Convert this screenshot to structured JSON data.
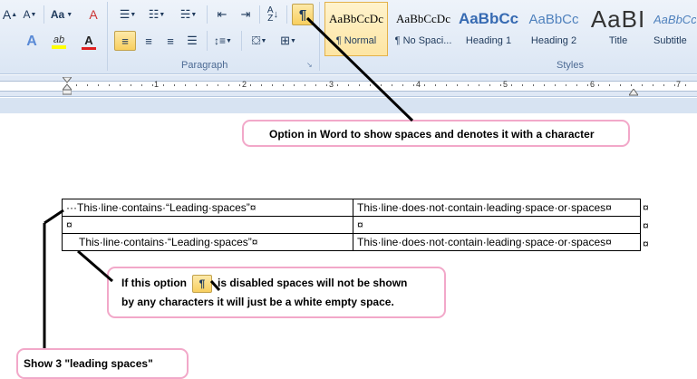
{
  "ribbon": {
    "font_row1": {
      "grow_font": "A",
      "shrink_font": "A",
      "change_case": "Aa",
      "clear_format": "A"
    },
    "font_row2": {
      "text_effects": "A",
      "highlight": "ab",
      "font_color": "A"
    },
    "paragraph_label": "Paragraph",
    "styles_label": "Styles",
    "show_hide_symbol": "¶",
    "styles": [
      {
        "sample": "AaBbCcDc",
        "name": "¶ Normal"
      },
      {
        "sample": "AaBbCcDc",
        "name": "¶ No Spaci..."
      },
      {
        "sample": "AaBbCc",
        "name": "Heading 1"
      },
      {
        "sample": "AaBbCc",
        "name": "Heading 2"
      },
      {
        "sample": "AaBI",
        "name": "Title"
      },
      {
        "sample": "AaBbCc",
        "name": "Subtitle"
      }
    ]
  },
  "ruler": {
    "numbers": [
      "1",
      "2",
      "3",
      "4",
      "5",
      "6",
      "7"
    ]
  },
  "callouts": {
    "top": "Option in Word to show spaces and denotes it with a character",
    "middle_before": "If this option",
    "middle_after": "is disabled spaces will not be shown",
    "middle_line2": "by any characters it will just be a white empty space.",
    "bottom": "Show 3 \"leading spaces\""
  },
  "table": {
    "rows": [
      [
        "···This·line·contains·“Leading·spaces”¤",
        "This·line·does·not·contain·leading·space·or·spaces¤"
      ],
      [
        "¤",
        "¤"
      ],
      [
        "This·line·contains·“Leading·spaces”¤",
        "This·line·does·not·contain·leading·space·or·spaces¤"
      ]
    ],
    "end_marks": [
      "¤",
      "¤",
      "¤"
    ]
  }
}
